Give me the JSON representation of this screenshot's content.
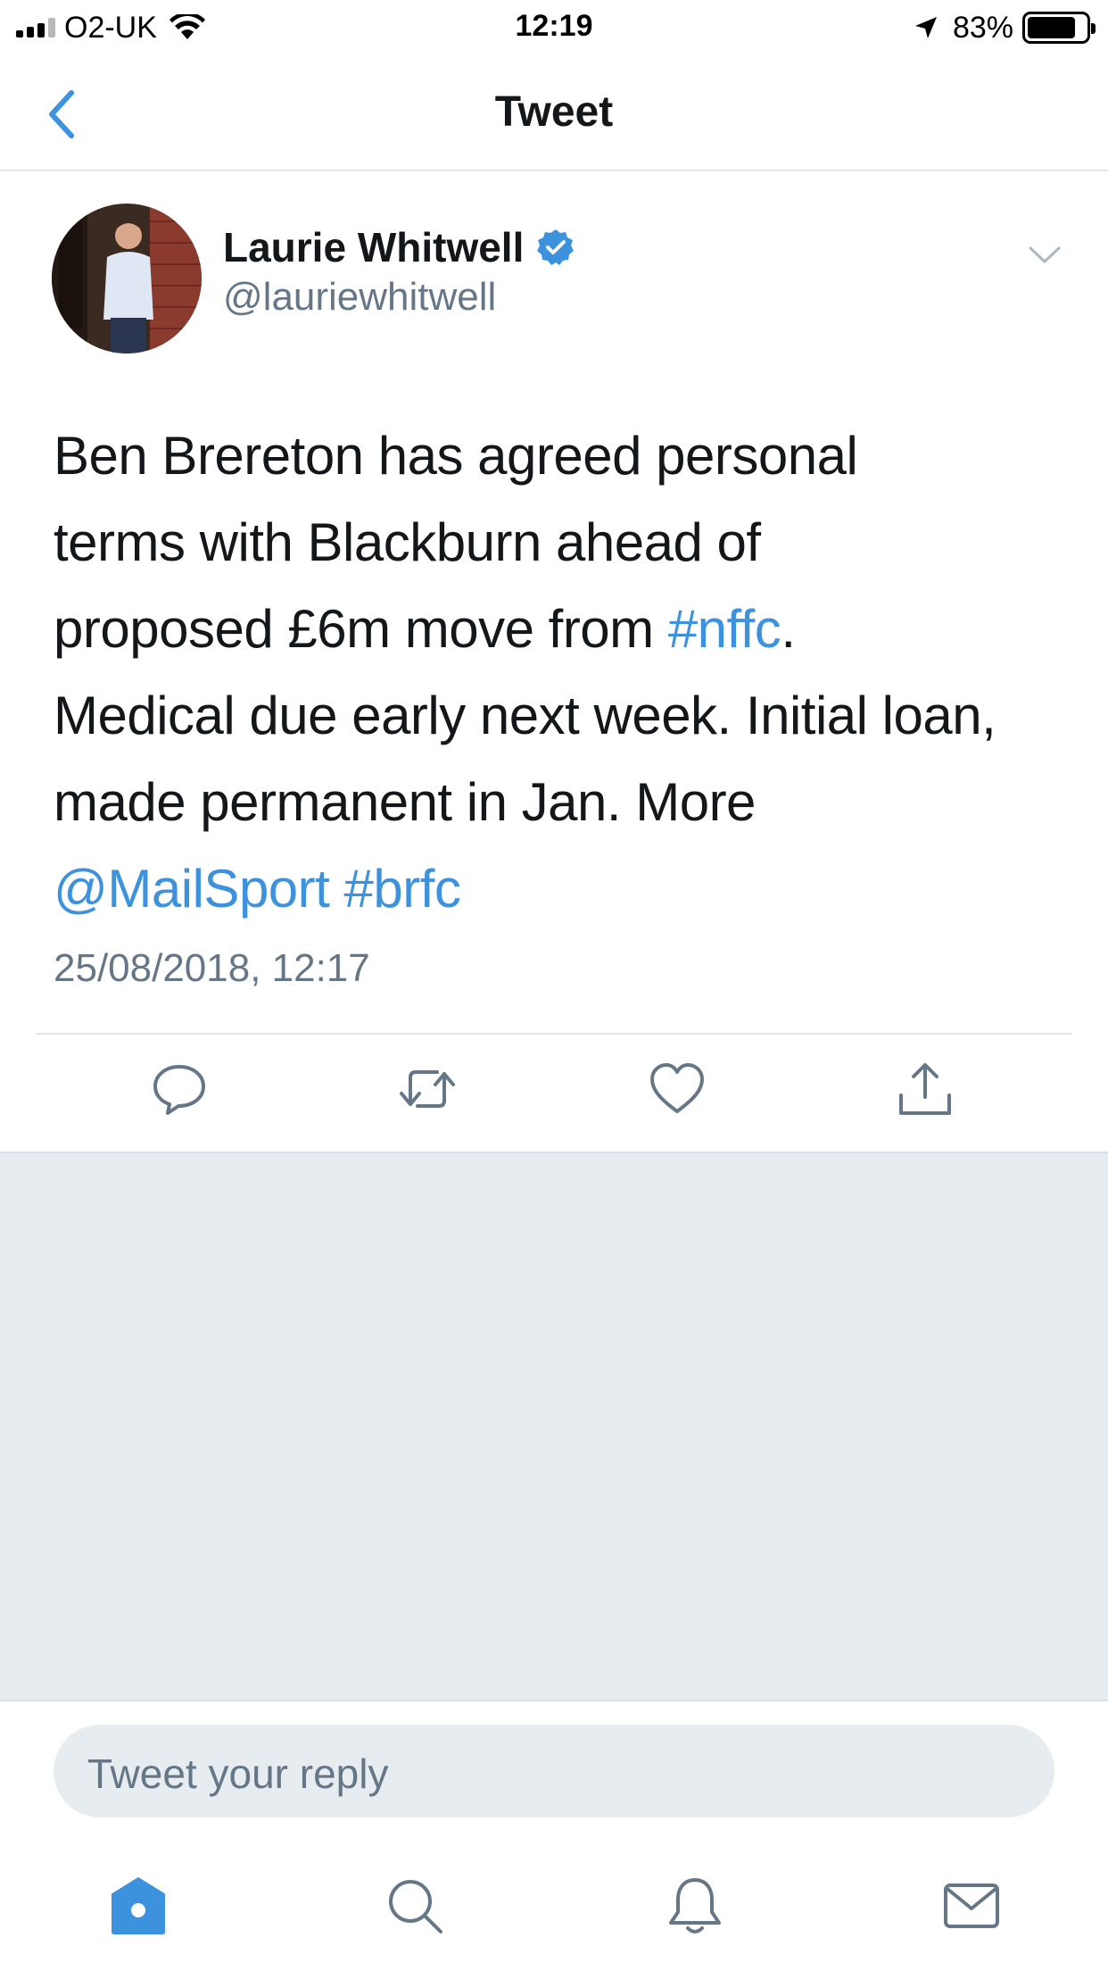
{
  "status_bar": {
    "carrier": "O2-UK",
    "time": "12:19",
    "battery": "83%",
    "battery_level": 0.83
  },
  "nav": {
    "title": "Tweet"
  },
  "tweet": {
    "author_name": "Laurie Whitwell",
    "author_handle": "@lauriewhitwell",
    "verified": true,
    "text_lines": [
      {
        "a": "Ben Brereton has agreed personal"
      },
      {
        "a": "terms with Blackburn ahead of"
      },
      {
        "a": "proposed £6m move from ",
        "link1": "#nffc",
        "b": "."
      },
      {
        "a": "Medical due early next week. Initial loan,"
      },
      {
        "a": "made permanent in Jan. More"
      },
      {
        "link1": "@MailSport",
        "a": " ",
        "link2": "#brfc"
      }
    ],
    "timestamp": "25/08/2018, 12:17"
  },
  "reply": {
    "placeholder": "Tweet your reply"
  },
  "colors": {
    "accent": "#3d92dd",
    "secondary_text": "#657786",
    "background_gray": "#e6ecf0"
  },
  "icons": {
    "actions": [
      "reply-icon",
      "retweet-icon",
      "like-icon",
      "share-icon"
    ],
    "tabs": [
      "home-icon",
      "search-icon",
      "notifications-icon",
      "messages-icon"
    ]
  }
}
